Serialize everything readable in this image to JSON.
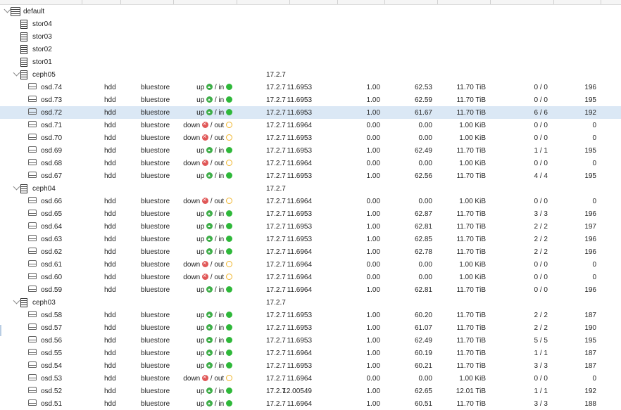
{
  "root": {
    "name": "default"
  },
  "hosts_top": [
    {
      "name": "stor04"
    },
    {
      "name": "stor03"
    },
    {
      "name": "stor02"
    },
    {
      "name": "stor01"
    }
  ],
  "groups": [
    {
      "host": {
        "name": "ceph05",
        "version": "17.2.7"
      },
      "osds": [
        {
          "name": "osd.74",
          "cls": "hdd",
          "type": "bluestore",
          "status": "up",
          "state": "in",
          "version": "17.2.7",
          "weight": "11.6953",
          "reweight": "1.00",
          "used": "62.53",
          "total": "11.70 TiB",
          "pg": "0 / 0",
          "pgs": "196"
        },
        {
          "name": "osd.73",
          "cls": "hdd",
          "type": "bluestore",
          "status": "up",
          "state": "in",
          "version": "17.2.7",
          "weight": "11.6953",
          "reweight": "1.00",
          "used": "62.59",
          "total": "11.70 TiB",
          "pg": "0 / 0",
          "pgs": "195"
        },
        {
          "name": "osd.72",
          "cls": "hdd",
          "type": "bluestore",
          "status": "up",
          "state": "in",
          "version": "17.2.7",
          "weight": "11.6953",
          "reweight": "1.00",
          "used": "61.67",
          "total": "11.70 TiB",
          "pg": "6 / 6",
          "pgs": "192",
          "selected": true
        },
        {
          "name": "osd.71",
          "cls": "hdd",
          "type": "bluestore",
          "status": "down",
          "state": "out",
          "version": "17.2.7",
          "weight": "11.6964",
          "reweight": "0.00",
          "used": "0.00",
          "total": "1.00 KiB",
          "pg": "0 / 0",
          "pgs": "0"
        },
        {
          "name": "osd.70",
          "cls": "hdd",
          "type": "bluestore",
          "status": "down",
          "state": "out",
          "version": "17.2.7",
          "weight": "11.6953",
          "reweight": "0.00",
          "used": "0.00",
          "total": "1.00 KiB",
          "pg": "0 / 0",
          "pgs": "0"
        },
        {
          "name": "osd.69",
          "cls": "hdd",
          "type": "bluestore",
          "status": "up",
          "state": "in",
          "version": "17.2.7",
          "weight": "11.6953",
          "reweight": "1.00",
          "used": "62.49",
          "total": "11.70 TiB",
          "pg": "1 / 1",
          "pgs": "195"
        },
        {
          "name": "osd.68",
          "cls": "hdd",
          "type": "bluestore",
          "status": "down",
          "state": "out",
          "version": "17.2.7",
          "weight": "11.6964",
          "reweight": "0.00",
          "used": "0.00",
          "total": "1.00 KiB",
          "pg": "0 / 0",
          "pgs": "0"
        },
        {
          "name": "osd.67",
          "cls": "hdd",
          "type": "bluestore",
          "status": "up",
          "state": "in",
          "version": "17.2.7",
          "weight": "11.6953",
          "reweight": "1.00",
          "used": "62.56",
          "total": "11.70 TiB",
          "pg": "4 / 4",
          "pgs": "195"
        }
      ]
    },
    {
      "host": {
        "name": "ceph04",
        "version": "17.2.7"
      },
      "osds": [
        {
          "name": "osd.66",
          "cls": "hdd",
          "type": "bluestore",
          "status": "down",
          "state": "out",
          "version": "17.2.7",
          "weight": "11.6964",
          "reweight": "0.00",
          "used": "0.00",
          "total": "1.00 KiB",
          "pg": "0 / 0",
          "pgs": "0"
        },
        {
          "name": "osd.65",
          "cls": "hdd",
          "type": "bluestore",
          "status": "up",
          "state": "in",
          "version": "17.2.7",
          "weight": "11.6953",
          "reweight": "1.00",
          "used": "62.87",
          "total": "11.70 TiB",
          "pg": "3 / 3",
          "pgs": "196"
        },
        {
          "name": "osd.64",
          "cls": "hdd",
          "type": "bluestore",
          "status": "up",
          "state": "in",
          "version": "17.2.7",
          "weight": "11.6953",
          "reweight": "1.00",
          "used": "62.81",
          "total": "11.70 TiB",
          "pg": "2 / 2",
          "pgs": "197"
        },
        {
          "name": "osd.63",
          "cls": "hdd",
          "type": "bluestore",
          "status": "up",
          "state": "in",
          "version": "17.2.7",
          "weight": "11.6953",
          "reweight": "1.00",
          "used": "62.85",
          "total": "11.70 TiB",
          "pg": "2 / 2",
          "pgs": "196"
        },
        {
          "name": "osd.62",
          "cls": "hdd",
          "type": "bluestore",
          "status": "up",
          "state": "in",
          "version": "17.2.7",
          "weight": "11.6964",
          "reweight": "1.00",
          "used": "62.78",
          "total": "11.70 TiB",
          "pg": "2 / 2",
          "pgs": "196"
        },
        {
          "name": "osd.61",
          "cls": "hdd",
          "type": "bluestore",
          "status": "down",
          "state": "out",
          "version": "17.2.7",
          "weight": "11.6964",
          "reweight": "0.00",
          "used": "0.00",
          "total": "1.00 KiB",
          "pg": "0 / 0",
          "pgs": "0"
        },
        {
          "name": "osd.60",
          "cls": "hdd",
          "type": "bluestore",
          "status": "down",
          "state": "out",
          "version": "17.2.7",
          "weight": "11.6964",
          "reweight": "0.00",
          "used": "0.00",
          "total": "1.00 KiB",
          "pg": "0 / 0",
          "pgs": "0"
        },
        {
          "name": "osd.59",
          "cls": "hdd",
          "type": "bluestore",
          "status": "up",
          "state": "in",
          "version": "17.2.7",
          "weight": "11.6964",
          "reweight": "1.00",
          "used": "62.81",
          "total": "11.70 TiB",
          "pg": "0 / 0",
          "pgs": "196"
        }
      ]
    },
    {
      "host": {
        "name": "ceph03",
        "version": "17.2.7"
      },
      "osds": [
        {
          "name": "osd.58",
          "cls": "hdd",
          "type": "bluestore",
          "status": "up",
          "state": "in",
          "version": "17.2.7",
          "weight": "11.6953",
          "reweight": "1.00",
          "used": "60.20",
          "total": "11.70 TiB",
          "pg": "2 / 2",
          "pgs": "187"
        },
        {
          "name": "osd.57",
          "cls": "hdd",
          "type": "bluestore",
          "status": "up",
          "state": "in",
          "version": "17.2.7",
          "weight": "11.6953",
          "reweight": "1.00",
          "used": "61.07",
          "total": "11.70 TiB",
          "pg": "2 / 2",
          "pgs": "190"
        },
        {
          "name": "osd.56",
          "cls": "hdd",
          "type": "bluestore",
          "status": "up",
          "state": "in",
          "version": "17.2.7",
          "weight": "11.6953",
          "reweight": "1.00",
          "used": "62.49",
          "total": "11.70 TiB",
          "pg": "5 / 5",
          "pgs": "195"
        },
        {
          "name": "osd.55",
          "cls": "hdd",
          "type": "bluestore",
          "status": "up",
          "state": "in",
          "version": "17.2.7",
          "weight": "11.6964",
          "reweight": "1.00",
          "used": "60.19",
          "total": "11.70 TiB",
          "pg": "1 / 1",
          "pgs": "187"
        },
        {
          "name": "osd.54",
          "cls": "hdd",
          "type": "bluestore",
          "status": "up",
          "state": "in",
          "version": "17.2.7",
          "weight": "11.6953",
          "reweight": "1.00",
          "used": "60.21",
          "total": "11.70 TiB",
          "pg": "3 / 3",
          "pgs": "187"
        },
        {
          "name": "osd.53",
          "cls": "hdd",
          "type": "bluestore",
          "status": "down",
          "state": "out",
          "version": "17.2.7",
          "weight": "11.6964",
          "reweight": "0.00",
          "used": "0.00",
          "total": "1.00 KiB",
          "pg": "0 / 0",
          "pgs": "0"
        },
        {
          "name": "osd.52",
          "cls": "hdd",
          "type": "bluestore",
          "status": "up",
          "state": "in",
          "version": "17.2.7",
          "weight": "12.00549",
          "reweight": "1.00",
          "used": "62.65",
          "total": "12.01 TiB",
          "pg": "1 / 1",
          "pgs": "192"
        },
        {
          "name": "osd.51",
          "cls": "hdd",
          "type": "bluestore",
          "status": "up",
          "state": "in",
          "version": "17.2.7",
          "weight": "11.6964",
          "reweight": "1.00",
          "used": "60.51",
          "total": "11.70 TiB",
          "pg": "3 / 3",
          "pgs": "188"
        }
      ]
    }
  ],
  "colors": {
    "up": "#3fae49",
    "down": "#e05757",
    "in": "#2fb83a",
    "out": "#f0b429",
    "selected": "#dbe8f5"
  },
  "icons": {
    "root": "rack-icon",
    "host": "server-icon",
    "osd": "disk-icon",
    "up": "arrow-up-circle-icon",
    "down": "x-circle-icon",
    "in": "filled-dot-icon",
    "out": "ring-icon",
    "expand": "chevron-down-icon"
  }
}
